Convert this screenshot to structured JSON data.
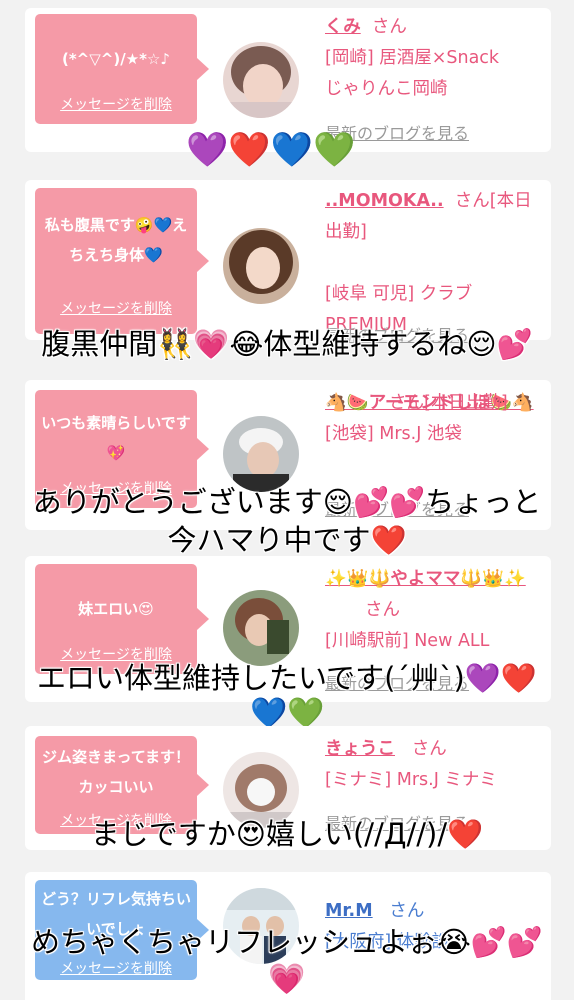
{
  "cards": [
    {
      "bubble_text": "(*^▽^)/★*☆♪",
      "delete_label": "メッセージを削除",
      "name": "くみ",
      "san": "さん",
      "line2": "[岡崎] 居酒屋×Snack",
      "line3": "じゃりんこ岡崎",
      "blog_label": "最新のブログを見る",
      "overlay": "💜❤️💙💚"
    },
    {
      "bubble_text": "私も腹黒です🤪💙えちえち身体💙",
      "delete_label": "メッセージを削除",
      "name": "..MOMOKA..",
      "san": "さん[本日出勤]",
      "line2": "[岐阜 可児] クラブ",
      "line3": "PREMIUM",
      "blog_label": "最新のブログを見る",
      "overlay": "腹黒仲間👯‍♀️💗😂体型維持するね😌💕"
    },
    {
      "bubble_text": "いつも素晴らしいです💖",
      "delete_label": "メッセージを削除",
      "name": "🐴🍉アーモンドしほ🍉🐴",
      "san": "さん[本日出勤]",
      "line2": "[池袋] Mrs.J 池袋",
      "blog_label": "最新のブログを見る",
      "overlay1": "ありがとうございます😌💕💕ちょっと",
      "overlay2": "今ハマり中です❤️"
    },
    {
      "bubble_text": "妹エロい😍",
      "delete_label": "メッセージを削除",
      "name": "✨👑🔱やよママ🔱👑✨",
      "san": "さん",
      "line2": "[川崎駅前] New ALL",
      "blog_label": "最新のブログを見る",
      "overlay1": "エロい体型維持したいです(´艸`)💜❤️",
      "overlay2": "💙💚"
    },
    {
      "bubble_text": "ジム姿きまってます！カッコいい",
      "delete_label": "メッセージを削除",
      "name": "きょうこ",
      "san": "さん",
      "line2": "[ミナミ] Mrs.J ミナミ",
      "blog_label": "最新のブログを見る",
      "overlay": "まじですか😍嬉しい(//Д//)/❤️"
    },
    {
      "bubble_text": "どう？リフレ気持ちいいでしょ",
      "delete_label": "メッセージを削除",
      "name": "Mr.M",
      "san": "さん",
      "line2": "[大阪府] 体験談…",
      "overlay1": "めちゃくちゃリフレッシュよぉ😭💕💕",
      "overlay2": "💗"
    }
  ]
}
